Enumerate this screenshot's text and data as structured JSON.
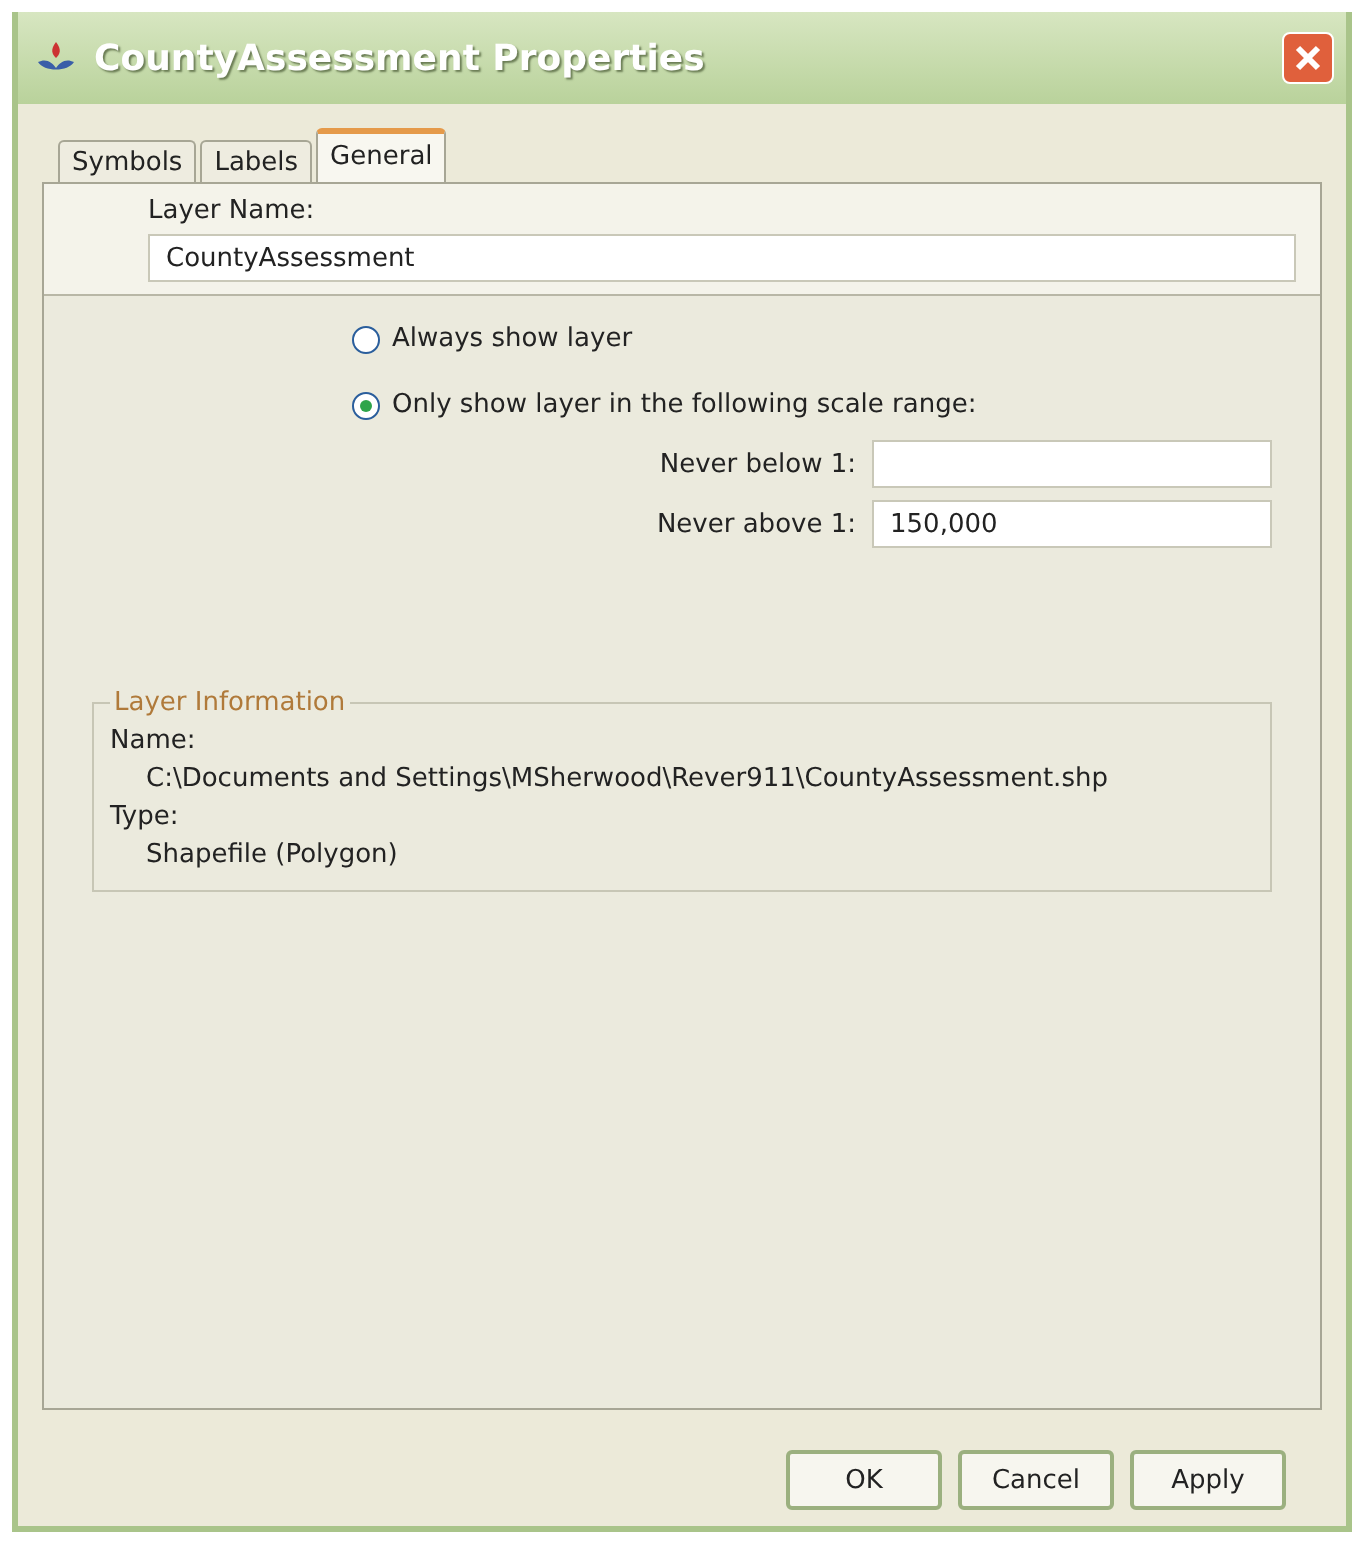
{
  "window": {
    "title": "CountyAssessment Properties"
  },
  "tabs": [
    {
      "label": "Symbols",
      "selected": false
    },
    {
      "label": "Labels",
      "selected": false
    },
    {
      "label": "General",
      "selected": true
    }
  ],
  "layer_name": {
    "label": "Layer Name:",
    "value": "CountyAssessment"
  },
  "visibility": [
    {
      "label": "Always show layer",
      "selected": false
    },
    {
      "label": "Only show layer in the following scale range:",
      "selected": true
    }
  ],
  "scale_fields": [
    {
      "label": "Never below 1:"
    },
    {
      "label": "Never above 1:",
      "value": "150,000"
    }
  ],
  "layer_information": {
    "title": "Layer Information",
    "name_label": "Name:",
    "name_value": "C:\\Documents and Settings\\MSherwood\\Rever911\\CountyAssessment.shp",
    "type_label": "Type:",
    "type_value": "Shapefile (Polygon)"
  },
  "buttons": [
    "OK",
    "Cancel",
    "Apply"
  ]
}
